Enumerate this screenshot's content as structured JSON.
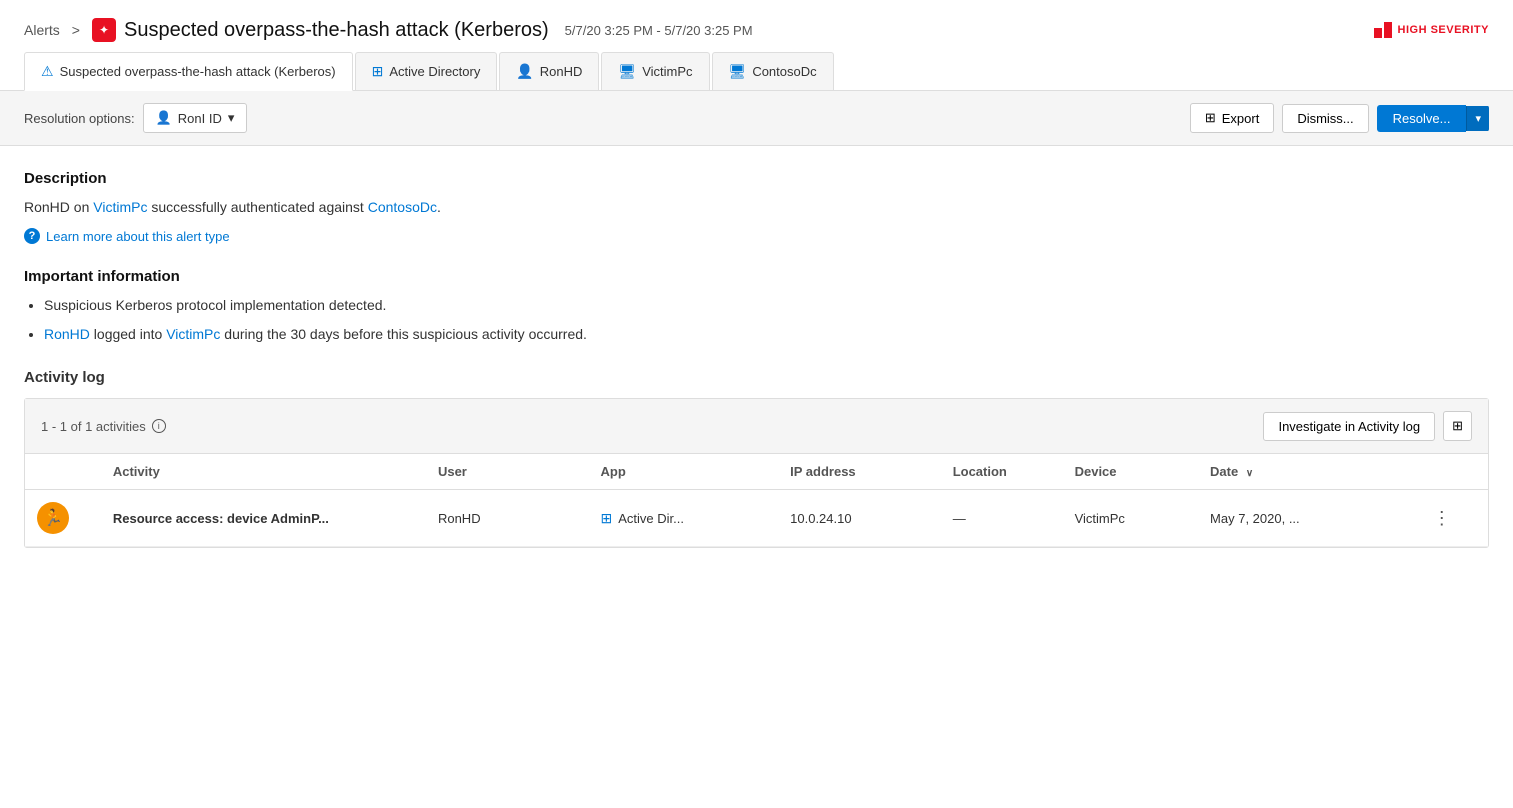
{
  "header": {
    "breadcrumb": "Alerts",
    "sep": ">",
    "title": "Suspected overpass-the-hash attack (Kerberos)",
    "dates": "5/7/20 3:25 PM - 5/7/20 3:25 PM",
    "severity_label": "HIGH SEVERITY"
  },
  "entity_tabs": [
    {
      "label": "Suspected overpass-the-hash attack (Kerberos)",
      "icon": "alert"
    },
    {
      "label": "Active Directory",
      "icon": "windows"
    },
    {
      "label": "RonHD",
      "icon": "user"
    },
    {
      "label": "VictimPc",
      "icon": "device"
    },
    {
      "label": "ContosoDc",
      "icon": "device"
    }
  ],
  "toolbar": {
    "resolution_label": "Resolution options:",
    "resolution_value": "RonI ID",
    "export_label": "Export",
    "dismiss_label": "Dismiss...",
    "resolve_label": "Resolve..."
  },
  "description": {
    "title": "Description",
    "text_before_link1": "RonHD on ",
    "link1": "VictimPc",
    "text_after_link1": " successfully authenticated against ",
    "link2": "ContosoDc",
    "text_end": ".",
    "learn_more": "Learn more about this alert type"
  },
  "important": {
    "title": "Important information",
    "bullets": [
      {
        "text": "Suspicious Kerberos protocol implementation detected.",
        "has_link": false
      },
      {
        "before": "",
        "link1": "RonHD",
        "middle": " logged into ",
        "link2": "VictimPc",
        "after": " during the 30 days before this suspicious activity occurred.",
        "has_link": true
      }
    ]
  },
  "activity_log": {
    "title": "Activity log",
    "count_text": "1 - 1 of 1 activities",
    "investigate_label": "Investigate in Activity log",
    "table": {
      "headers": [
        "",
        "Activity",
        "User",
        "App",
        "IP address",
        "Location",
        "Device",
        "Date"
      ],
      "rows": [
        {
          "activity": "Resource access: device AdminP...",
          "user": "RonHD",
          "app": "Active Dir...",
          "ip": "10.0.24.10",
          "location": "—",
          "device": "VictimPc",
          "date": "May 7, 2020, ..."
        }
      ]
    }
  }
}
